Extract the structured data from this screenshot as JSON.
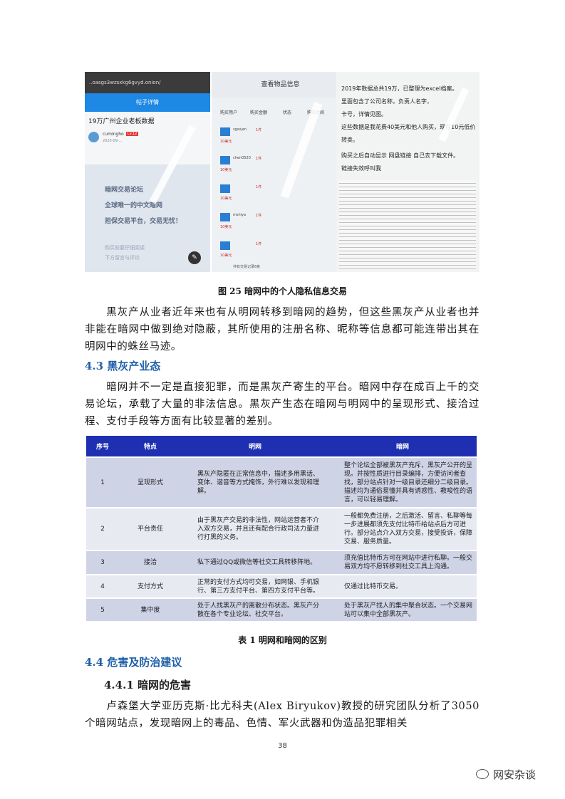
{
  "figure": {
    "shot1": {
      "url": "..oasgs3wzsxkg6gvyd.onion/",
      "app_title": "帖子详情",
      "post_title": "19万广州企业老板数据",
      "author": "cumingho",
      "badge": "Lv.12",
      "date": "2020-09-...",
      "banner_lines": [
        "暗网交易论坛",
        "全球唯一的中文暗网",
        "担保交易平台，交易无忧！"
      ],
      "bottom_lines": [
        "购买前要仔细阅读",
        "下方留言与评论"
      ]
    },
    "shot2": {
      "header": "查看物品信息",
      "columns": [
        "购买用户",
        "购买金额",
        "状态",
        "购买时间"
      ],
      "rows": [
        {
          "buyer": "sgsxjan",
          "qty": "1件",
          "price": "10美元"
        },
        {
          "buyer": "chen0520",
          "qty": "1件",
          "price": "10美元"
        },
        {
          "buyer": "",
          "qty": "1件",
          "price": "10美元"
        },
        {
          "buyer": "mshiya",
          "qty": "1件",
          "price": "10美元"
        },
        {
          "buyer": "",
          "qty": "1件",
          "price": "10美元"
        }
      ],
      "total": "共有交易记录6条"
    },
    "shot3": {
      "lines": [
        "2019年数据总共19万，已整理为excel档案。",
        "里面包含了公司名称，负责人名字，",
        "卡号，详情见图。",
        "这些数据是我花费40美元和他人购买，现在10元低价",
        "转卖。",
        "",
        "购买之后自动显示 网盘链接 自己去下载文件。",
        "链接失效呼叫我"
      ]
    },
    "caption": "图 25  暗网中的个人隐私信息交易"
  },
  "para1": "黑灰产从业者近年来也有从明网转移到暗网的趋势，但这些黑灰产从业者也并非能在暗网中做到绝对隐蔽，其所使用的注册名称、昵称等信息都可能连带出其在明网中的蛛丝马迹。",
  "section_4_3": "4.3 黑灰产业态",
  "para2": "暗网并不一定是直接犯罪，而是黑灰产寄生的平台。暗网中存在成百上千的交易论坛，承载了大量的非法信息。黑灰产生态在暗网与明网中的呈现形式、接洽过程、支付手段等方面有比较显著的差别。",
  "table": {
    "headers": [
      "序号",
      "特点",
      "明网",
      "暗网"
    ],
    "rows": [
      {
        "no": "1",
        "feature": "呈现形式",
        "clear": "黑灰产隐匿在正常信息中，描述多用黑话、变体、谐音等方式掩饰，外行难以发现和理解。",
        "dark": "整个论坛全部被黑灰产充斥，黑灰产公开的呈现。并按性质进行目录编排，方便访问者查找，部分站点针对一级目录还细分二级目录。描述均为通俗易懂并具有诱惑性、教唆性的语言，可以轻易理解。"
      },
      {
        "no": "2",
        "feature": "平台责任",
        "clear": "由于黑灰产交易的非法性，网站运营者不介入双方交易，并且还有配合行政司法力量进行打黑的义务。",
        "dark": "一般都免费注册，之后激活、留言、私聊等每一步进展都须先支付比特币给站点后方可进行。部分站点介入双方交易，接受投诉，保障交易、服务质量。"
      },
      {
        "no": "3",
        "feature": "接洽",
        "clear": "私下通过QQ或微信等社交工具转移阵地。",
        "dark": "须充值比特币方可在网站中进行私聊。一般交易双方均不愿转移到社交工具上沟通。"
      },
      {
        "no": "4",
        "feature": "支付方式",
        "clear": "正常的支付方式均可交易，如网银、手机银行、第三方支付平台、第四方支付平台等。",
        "dark": "仅通过比特币交易。"
      },
      {
        "no": "5",
        "feature": "集中度",
        "clear": "处于人找黑灰产的离散分布状态。黑灰产分散在各个专业论坛、社交平台。",
        "dark": "处于黑灰产找人的集中聚合状态。一个交易网站可以集中全部黑灰产。"
      }
    ],
    "caption": "表 1  明网和暗网的区别"
  },
  "section_4_4": "4.4 危害及防治建议",
  "section_4_4_1": "4.4.1 暗网的危害",
  "para3": "卢森堡大学亚历克斯·比尤科夫(Alex Biryukov)教授的研究团队分析了3050个暗网站点，发现暗网上的毒品、色情、军火武器和伪造品犯罪相关",
  "page_number": "38",
  "watermark": "网安杂谈"
}
